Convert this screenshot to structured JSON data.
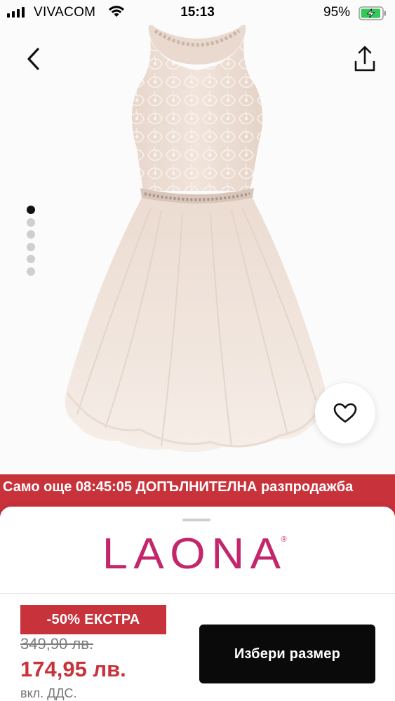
{
  "status_bar": {
    "carrier": "VIVACOM",
    "time": "15:13",
    "battery_percent": "95%",
    "battery_level": 0.95,
    "charging": true
  },
  "product": {
    "image_description_icon": "dress-photo",
    "pager": {
      "total": 6,
      "active_index": 0
    }
  },
  "promo": {
    "text": "Само още 08:45:05 ДОПЪЛНИТЕЛНА разпродажба"
  },
  "brand": {
    "name": "LAONA",
    "reg_mark": "®",
    "color": "#c3266b"
  },
  "pricing": {
    "discount_badge": "-50% ЕКСТРА",
    "old_price": "349,90 лв.",
    "new_price": "174,95 лв.",
    "vat_note": "вкл. ДДС."
  },
  "actions": {
    "select_size_label": "Избери размер"
  },
  "colors": {
    "accent_red": "#c8323b",
    "brand_pink": "#c3266b",
    "button_black": "#0a0a0a"
  }
}
